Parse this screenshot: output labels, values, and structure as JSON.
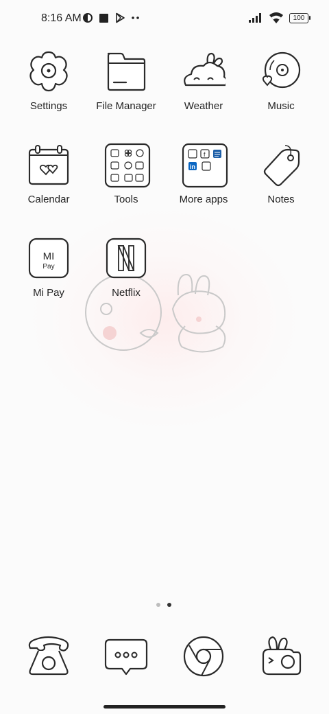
{
  "status_bar": {
    "time": "8:16 AM",
    "battery": "100",
    "left_icons": [
      "vpn-icon",
      "stop-icon",
      "play-store-icon",
      "more-dots-icon"
    ],
    "right_icons": [
      "signal-icon",
      "wifi-icon",
      "battery-icon"
    ]
  },
  "home": {
    "apps": [
      {
        "label": "Settings",
        "icon": "settings-flower-icon"
      },
      {
        "label": "File Manager",
        "icon": "folder-icon"
      },
      {
        "label": "Weather",
        "icon": "cloud-bunny-icon"
      },
      {
        "label": "Music",
        "icon": "vinyl-heart-icon"
      },
      {
        "label": "Calendar",
        "icon": "calendar-hearts-icon"
      },
      {
        "label": "Tools",
        "icon": "tools-folder-icon"
      },
      {
        "label": "More apps",
        "icon": "more-apps-folder-icon"
      },
      {
        "label": "Notes",
        "icon": "tag-icon"
      },
      {
        "label": "Mi Pay",
        "icon": "mi-pay-icon"
      },
      {
        "label": "Netflix",
        "icon": "netflix-icon"
      }
    ],
    "mi_pay_text": [
      "MI",
      "Pay"
    ],
    "netflix_letter": "N"
  },
  "page_indicator": {
    "count": 2,
    "active_index": 1
  },
  "dock": {
    "apps": [
      {
        "icon": "phone-icon"
      },
      {
        "icon": "messages-icon"
      },
      {
        "icon": "chrome-icon"
      },
      {
        "icon": "camera-bunny-icon"
      }
    ]
  },
  "colors": {
    "background": "#fbfbfb",
    "stroke": "#2a2a2a",
    "linkedin_blue": "#0a66c2",
    "glow": "#ffe1e1"
  }
}
